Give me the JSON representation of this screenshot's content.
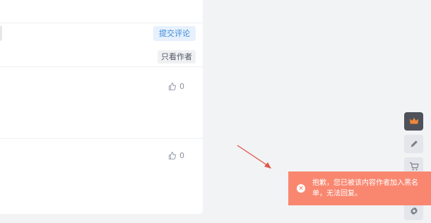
{
  "comment_box": {
    "submit_label": "提交评论"
  },
  "filter": {
    "author_only_label": "只看作者"
  },
  "comments": [
    {
      "likes": "0"
    },
    {
      "likes": "0"
    }
  ],
  "toast": {
    "message": "抱歉，您已被该内容作者加入黑名单，无法回复。",
    "icon": "error-icon",
    "color": "#f98770"
  },
  "sidebar": {
    "items": [
      {
        "icon": "crown-icon"
      },
      {
        "icon": "pencil-icon"
      },
      {
        "icon": "cart-icon"
      },
      {
        "icon": "gear-icon"
      }
    ]
  }
}
